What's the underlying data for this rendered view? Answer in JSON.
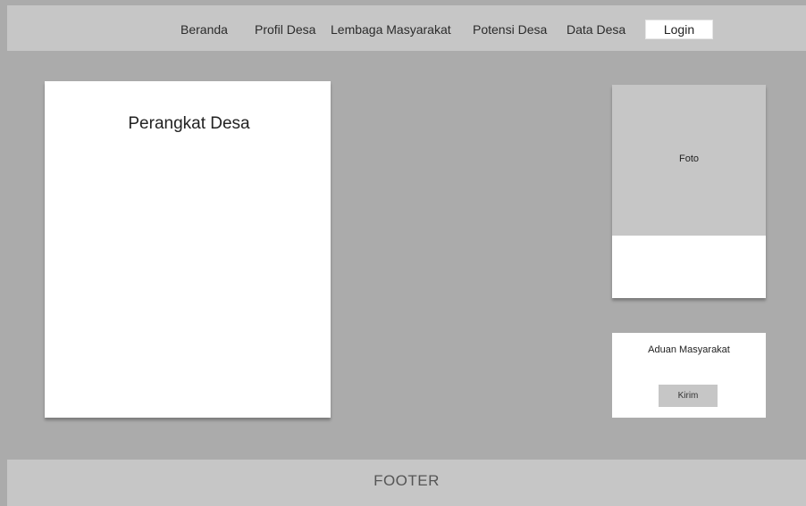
{
  "navbar": {
    "links": [
      {
        "label": "Beranda"
      },
      {
        "label": "Profil Desa"
      },
      {
        "label": "Lembaga Masyarakat"
      },
      {
        "label": "Potensi Desa"
      },
      {
        "label": "Data Desa"
      }
    ],
    "login_label": "Login"
  },
  "perangkat": {
    "title": "Perangkat Desa"
  },
  "foto": {
    "label": "Foto"
  },
  "aduan": {
    "title": "Aduan Masyarakat",
    "submit_label": "Kirim"
  },
  "footer": {
    "text": "FOOTER"
  },
  "colors": {
    "page_background": "#ababab",
    "bar_background": "#c6c6c6",
    "card_background": "#ffffff",
    "placeholder_background": "#c6c6c6"
  }
}
